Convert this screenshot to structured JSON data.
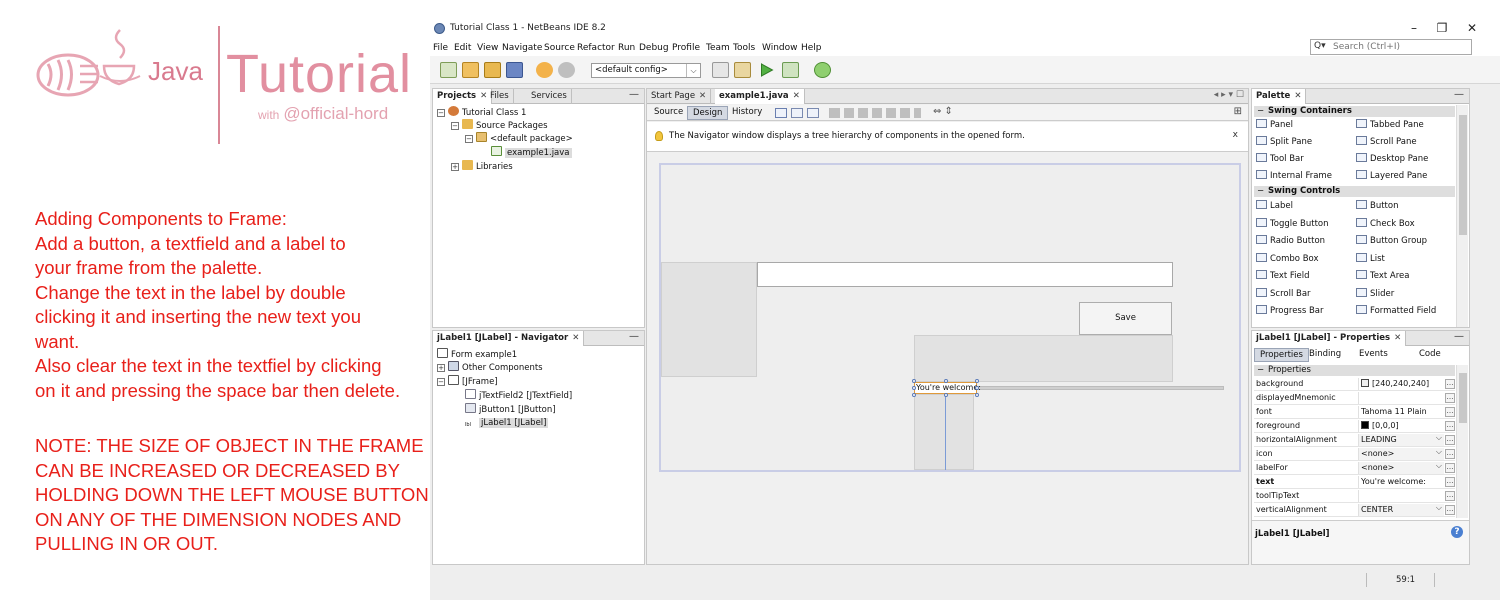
{
  "tutorial": {
    "logo_java": "Java",
    "logo_tutorial": "Tutorial",
    "logo_with": "with",
    "logo_handle": "@official-hord",
    "instructions": [
      "Adding Components to Frame:",
      "Add a button, a textfield and a label to",
      "your frame from the palette.",
      "Change the text in the label by double",
      "clicking it and inserting the new text you",
      "want.",
      "Also clear the text in the textfiel by clicking",
      "on it and pressing the space bar then delete."
    ],
    "note": [
      "NOTE: THE SIZE OF OBJECT IN THE FRAME",
      "CAN BE INCREASED OR DECREASED BY",
      "HOLDING DOWN THE LEFT MOUSE BUTTON",
      "ON ANY OF THE DIMENSION NODES AND",
      "PULLING IN OR OUT."
    ]
  },
  "window": {
    "title": "Tutorial Class 1 - NetBeans IDE 8.2",
    "controls": [
      "–",
      "❐",
      "✕"
    ]
  },
  "menu": [
    "File",
    "Edit",
    "View",
    "Navigate",
    "Source",
    "Refactor",
    "Run",
    "Debug",
    "Profile",
    "Team",
    "Tools",
    "Window",
    "Help"
  ],
  "search": {
    "icon": "Q▾",
    "placeholder": "Search (Ctrl+I)"
  },
  "toolbar": {
    "config": "<default config>"
  },
  "projects": {
    "tabs": [
      "Projects",
      "Files",
      "Services"
    ],
    "tree": [
      {
        "label": "Tutorial Class 1",
        "icon": "coffee-project-icon"
      },
      {
        "label": "Source Packages",
        "icon": "package-folder-icon"
      },
      {
        "label": "<default package>",
        "icon": "package-icon"
      },
      {
        "label": "example1.java",
        "icon": "form-file-icon"
      },
      {
        "label": "Libraries",
        "icon": "library-icon"
      }
    ]
  },
  "navigator": {
    "title": "jLabel1 [JLabel] - Navigator",
    "tree": [
      "Form example1",
      "Other Components",
      "[JFrame]",
      "jTextField2 [JTextField]",
      "jButton1 [JButton]",
      "jLabel1 [JLabel]"
    ]
  },
  "editor": {
    "tabs": [
      "Start Page",
      "example1.java"
    ],
    "subtabs": [
      "Source",
      "Design",
      "History"
    ],
    "hint": "The Navigator window displays a tree hierarchy of components in the opened form.",
    "hint_close": "x",
    "button_label": "Save",
    "label_text": "You're welcome:"
  },
  "palette": {
    "tab": "Palette",
    "groups": [
      {
        "name": "Swing Containers",
        "items": [
          "Panel",
          "Tabbed Pane",
          "Split Pane",
          "Scroll Pane",
          "Tool Bar",
          "Desktop Pane",
          "Internal Frame",
          "Layered Pane"
        ]
      },
      {
        "name": "Swing Controls",
        "items": [
          "Label",
          "Button",
          "Toggle Button",
          "Check Box",
          "Radio Button",
          "Button Group",
          "Combo Box",
          "List",
          "Text Field",
          "Text Area",
          "Scroll Bar",
          "Slider",
          "Progress Bar",
          "Formatted Field"
        ]
      }
    ]
  },
  "properties": {
    "tab": "jLabel1 [JLabel] - Properties",
    "subtabs": [
      "Properties",
      "Binding",
      "Events",
      "Code"
    ],
    "section": "Properties",
    "rows": [
      {
        "name": "background",
        "value": "[240,240,240]",
        "swatch": "#f0f0f0"
      },
      {
        "name": "displayedMnemonic",
        "value": ""
      },
      {
        "name": "font",
        "value": "Tahoma 11 Plain"
      },
      {
        "name": "foreground",
        "value": "[0,0,0]",
        "swatch": "#000000"
      },
      {
        "name": "horizontalAlignment",
        "value": "LEADING",
        "combo": true
      },
      {
        "name": "icon",
        "value": "<none>",
        "combo": true
      },
      {
        "name": "labelFor",
        "value": "<none>",
        "combo": true
      },
      {
        "name": "text",
        "value": "You're welcome:",
        "bold": true
      },
      {
        "name": "toolTipText",
        "value": ""
      },
      {
        "name": "verticalAlignment",
        "value": "CENTER",
        "combo": true
      }
    ],
    "footer": "jLabel1 [JLabel]"
  },
  "status": {
    "position": "59:1"
  },
  "colors": {
    "tutorial_text": "#e8201a",
    "logo": "#e28fa0",
    "selection": "#d4d9e2"
  }
}
